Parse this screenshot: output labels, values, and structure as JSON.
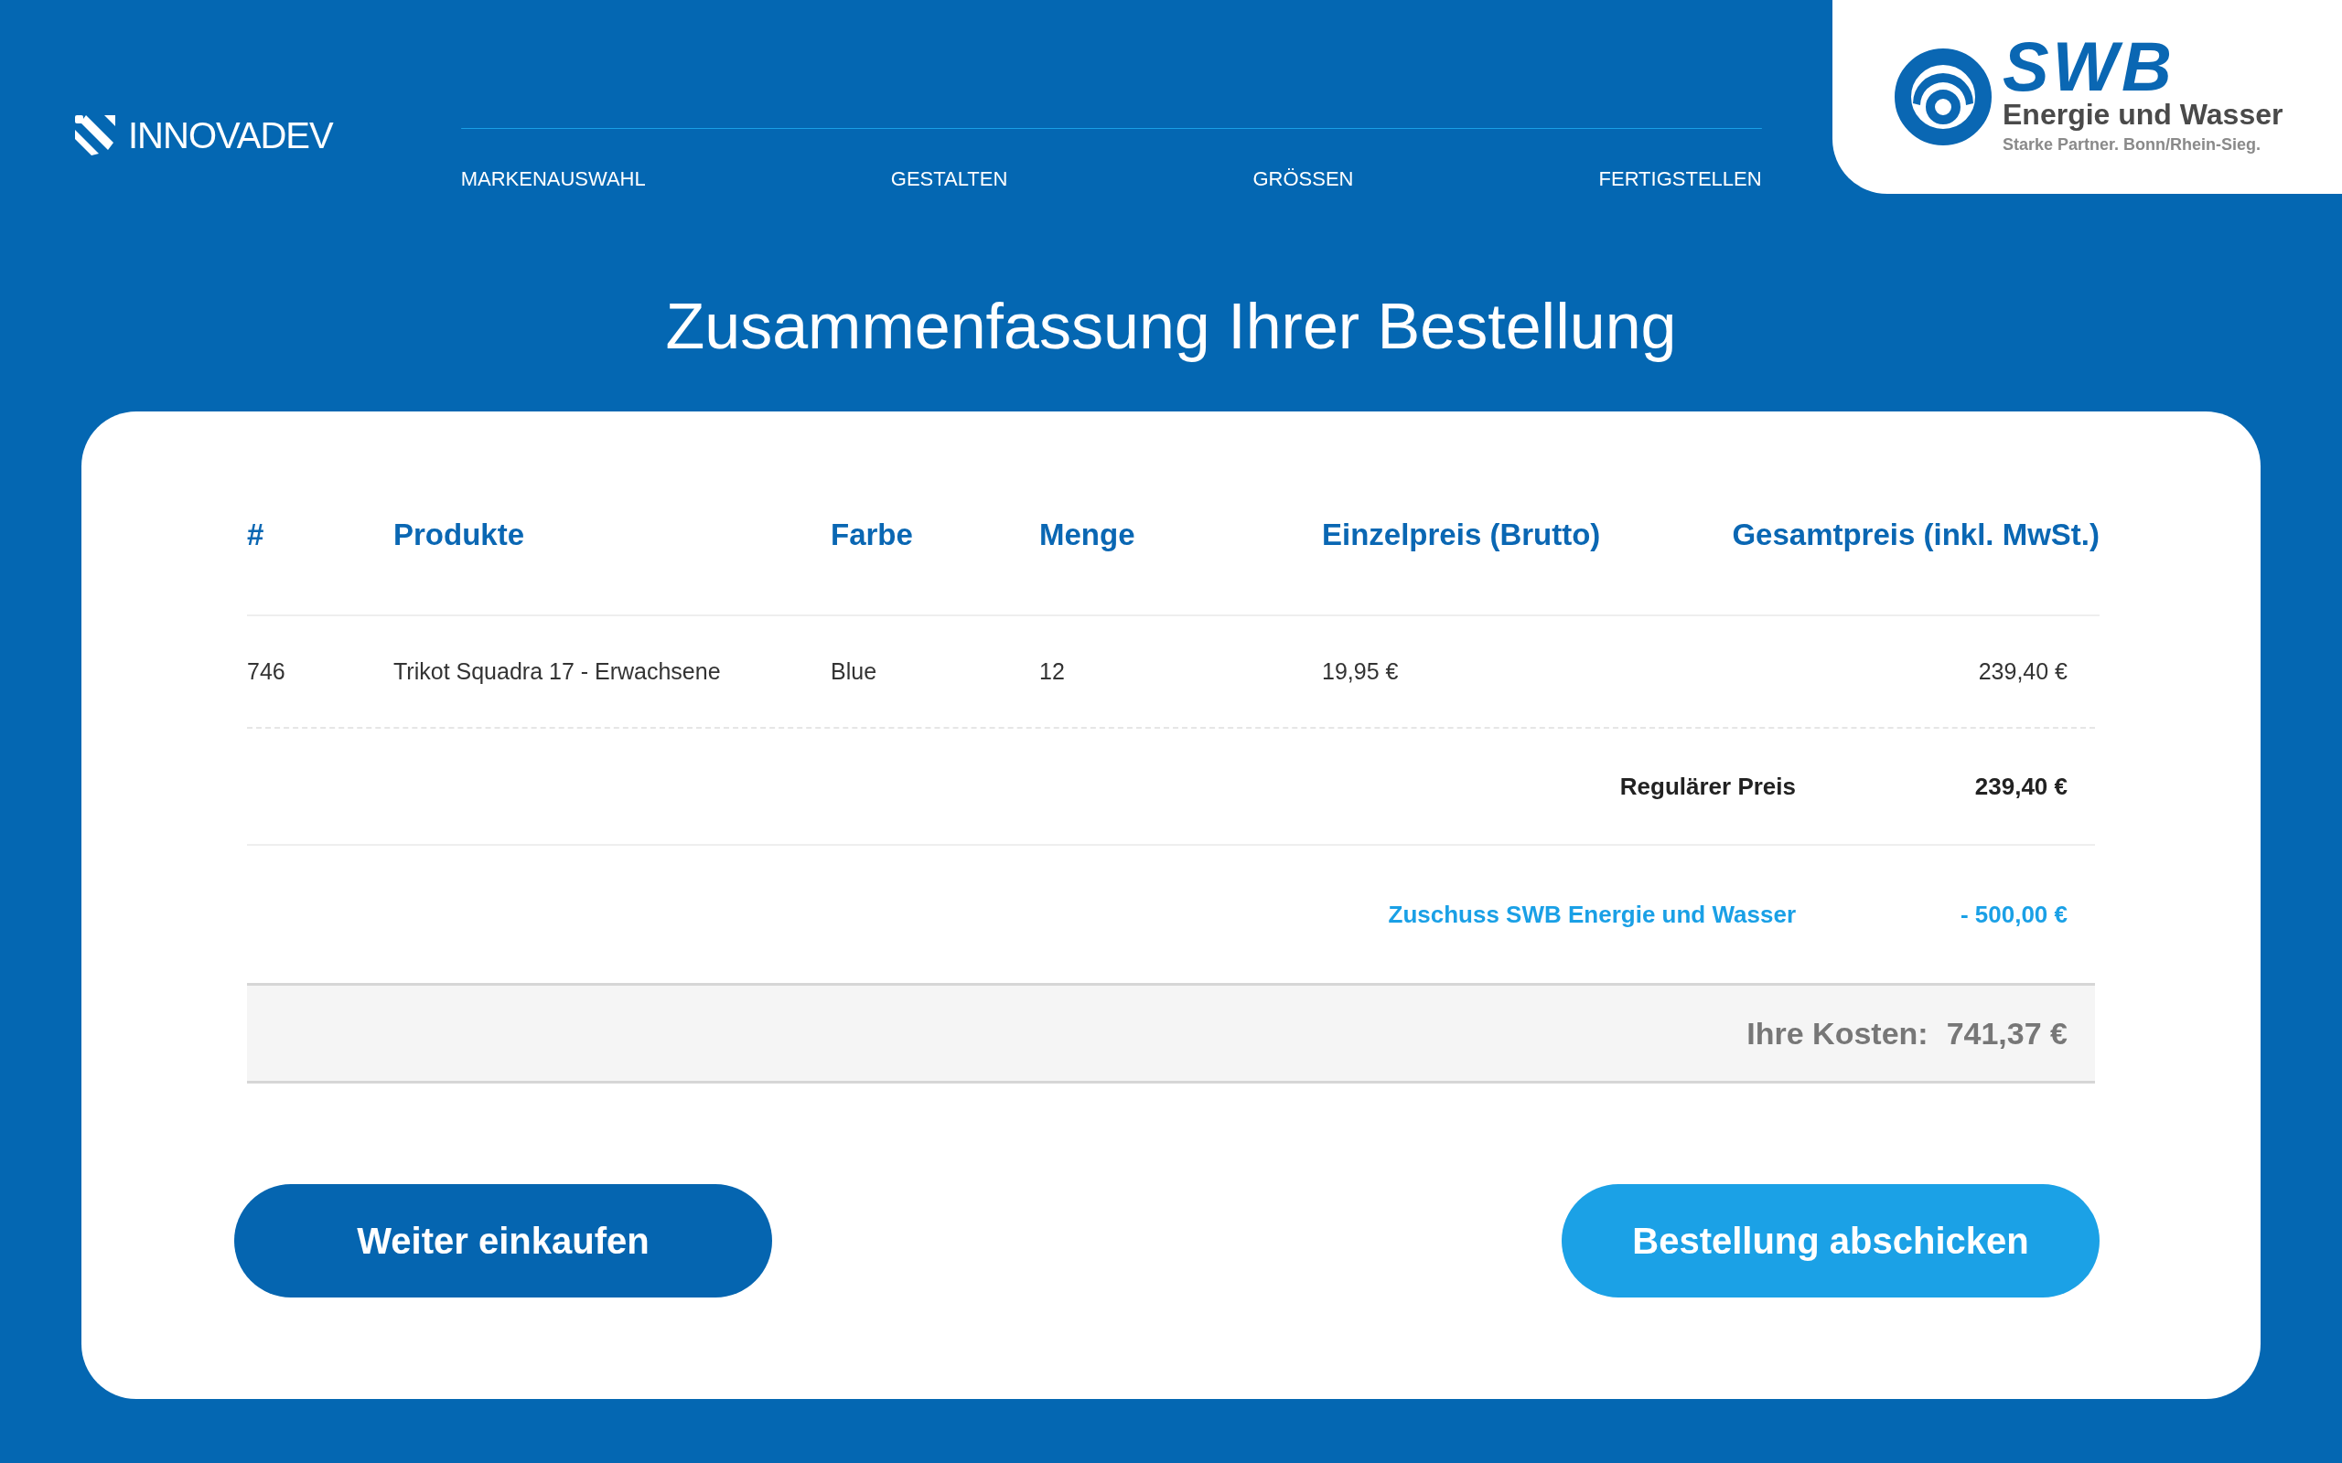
{
  "brand": {
    "name": "**INNOVA**DEV"
  },
  "progress": {
    "level": 1,
    "steps": [
      "MARKENAUSWAHL",
      "GESTALTEN",
      "GRÖSSEN",
      "FERTIGSTELLEN"
    ]
  },
  "partner_logo": {
    "name": "SWB",
    "subtitle": "Energie und Wasser",
    "tagline": "Starke Partner. Bonn/Rhein-Sieg."
  },
  "title": "Zusammenfassung Ihrer Bestellung",
  "table": {
    "columns": [
      "#",
      "Produkte",
      "Farbe",
      "Menge",
      "Einzelpreis (Brutto)",
      "Gesamtpreis (inkl. MwSt.)"
    ],
    "rows": [
      [
        "746",
        "Trikot Squadra 17 - Erwachsene",
        "Blue",
        "12",
        "19,95 €",
        "239,40 €"
      ]
    ]
  },
  "summary": [
    {
      "kind": "regular",
      "label": "Regulärer Preis",
      "value": "239,40 €"
    },
    {
      "kind": "subsidy",
      "label": "Zuschuss SWB Energie und Wasser",
      "value": "- 500,00 €"
    }
  ],
  "total": {
    "label": "Ihre Kosten:",
    "value": "741,37 €"
  },
  "buttons": [
    {
      "kind": "secondary",
      "label": "Weiter einkaufen"
    },
    {
      "kind": "primary",
      "label": "Bestellung abschicken"
    }
  ]
}
